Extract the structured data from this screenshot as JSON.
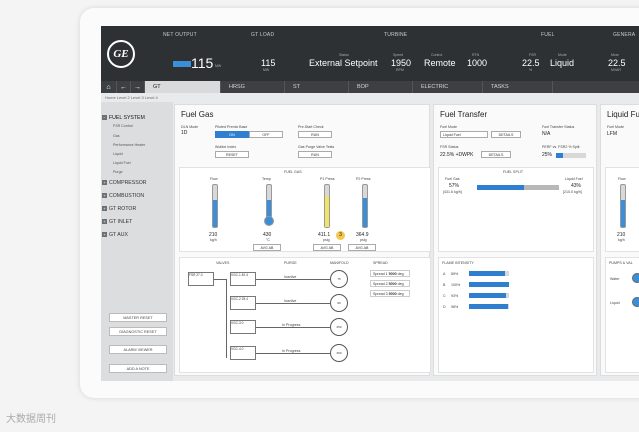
{
  "header": {
    "net_output_label": "NET OUTPUT",
    "net_output_value": "115",
    "net_output_unit": "MW",
    "gt_load_label": "GT LOAD",
    "gt_load_value": "115",
    "gt_load_unit": "MW",
    "turbine_label": "TURBINE",
    "status_label": "Status",
    "status_value": "External Setpoint",
    "speed_label": "Speed",
    "speed_value": "1950",
    "speed_unit": "RPM",
    "control_label": "Control",
    "control_value": "Remote",
    "rtn_label": "RTN",
    "rtn_value": "1000",
    "fuel_label": "FUEL",
    "fsr_label": "FSR",
    "fsr_value": "22.5",
    "fsr_unit": "%",
    "mode_label": "Mode",
    "mode_value": "Liquid",
    "gen_label": "GENERA",
    "gen_sub_label": "Mvar",
    "gen_value": "22.5",
    "gen_unit": "MVAR"
  },
  "tabs": [
    {
      "label": "GT"
    },
    {
      "label": "HRSG"
    },
    {
      "label": "ST"
    },
    {
      "label": "BOP"
    },
    {
      "label": "ELECTRIC"
    },
    {
      "label": "TASKS"
    }
  ],
  "breadcrumb": "Home   Level 2   Level 3   Level 4",
  "sidebar": {
    "fuel_system": "FUEL SYSTEM",
    "subitems": [
      "FSR Control",
      "Gas",
      "Performance Heater",
      "Liquid",
      "Liquid Fuel",
      "Purge"
    ],
    "compressor": "COMPRESSOR",
    "combustion": "COMBUSTION",
    "gt_rotor": "GT ROTOR",
    "gt_inlet": "GT INLET",
    "gt_aux": "GT AUX",
    "buttons": [
      "MASTER RESET",
      "DIAGNOSTIC RESET",
      "ALARM VIEWER",
      "ADD A NOTE"
    ]
  },
  "fuel_gas": {
    "title": "Fuel Gas",
    "dln_mode_label": "DLN Mode",
    "dln_mode_value": "1D",
    "piloted_label": "Piloted Premix Base",
    "on_label": "ON",
    "off_label": "OFF",
    "prestart_label": "Pre-Start Check",
    "run_label": "RUN",
    "wobbe_label": "Wobbe Index",
    "reset_label": "RESET",
    "gas_purge_label": "Gas Purge Valve Tests",
    "fuel_gas_section": "FUEL GAS",
    "flow_label": "Flow",
    "flow_value": "210",
    "flow_unit": "kg/h",
    "temp_label": "Temp",
    "temp_value": "430",
    "temp_unit": "°C",
    "p1_label": "P1 Press",
    "p1_value": "411.1",
    "p1_unit": "psig",
    "p2_label": "P2 Press",
    "p2_value": "364.9",
    "p2_unit": "psig",
    "alarm_count": "3",
    "avg_ab": "AVG AB",
    "valves_label": "VALVES",
    "purge_label": "PURGE",
    "manifold_label": "MANIFOLD",
    "spread_label": "SPREAD",
    "spread_rows": [
      {
        "label": "Spread 1",
        "value": "5000",
        "unit": "deg"
      },
      {
        "label": "Spread 2",
        "value": "5000",
        "unit": "deg"
      },
      {
        "label": "Spread 3",
        "value": "5000",
        "unit": "deg"
      }
    ],
    "valve_main": {
      "name": "FSR",
      "value": "27.0"
    },
    "valve_rows": [
      {
        "name": "VGC-1",
        "value": "40.4",
        "status": "Inactive",
        "dial": "75"
      },
      {
        "name": "VGC-2",
        "value": "25.4",
        "status": "Inactive",
        "dial": "90"
      },
      {
        "name": "VGC-3",
        "value": "0",
        "status": "In Progress",
        "dial": "250"
      },
      {
        "name": "VGC-4",
        "value": "0",
        "status": "In Progress",
        "dial": "250"
      }
    ]
  },
  "fuel_transfer": {
    "title": "Fuel Transfer",
    "fuel_mode_label": "Fuel Mode",
    "fuel_mode_value": "Liquid Fuel",
    "details_label": "DETAILS",
    "transfer_status_label": "Fuel Transfer Status",
    "transfer_status_value": "N/A",
    "fsr_status_label": "FSR Status",
    "fsr_status_value": "22.5% +DWPK",
    "perf_label": "PERF vs. FSR2 % Split",
    "perf_value": "25%",
    "fuel_split_label": "FUEL SPLIT",
    "fuel_gas_label": "Fuel Gas",
    "fuel_gas_pct": "57%",
    "fuel_gas_flow": "[431.6 kg/h]",
    "liquid_fuel_label": "Liquid Fuel",
    "liquid_fuel_pct": "43%",
    "liquid_fuel_flow": "[210.0 kg/h]",
    "split_fraction": 0.57,
    "flame_label": "FLAME INTENSITY",
    "flames": [
      {
        "name": "A",
        "value": "89%",
        "fraction": 0.89
      },
      {
        "name": "B",
        "value": "100%",
        "fraction": 1.0
      },
      {
        "name": "C",
        "value": "93%",
        "fraction": 0.93
      },
      {
        "name": "D",
        "value": "98%",
        "fraction": 0.98
      }
    ]
  },
  "liquid_fuel": {
    "title": "Liquid Fu",
    "fuel_mode_label": "Fuel Mode",
    "fuel_mode_value": "LFM",
    "flow_label": "Flow",
    "flow_value": "210",
    "flow_unit": "kg/h",
    "pumps_label": "PUMPS & VAL",
    "water_label": "Water",
    "liquid_label": "Liquid"
  },
  "gauge_levels": {
    "flow": 0.65,
    "temp": 0.55,
    "p1": 0.75,
    "p2": 0.7
  },
  "colors": {
    "accent": "#2f7fd1",
    "warning": "#f2c94c",
    "header": "#2d3134"
  },
  "watermark": "大数据周刊"
}
